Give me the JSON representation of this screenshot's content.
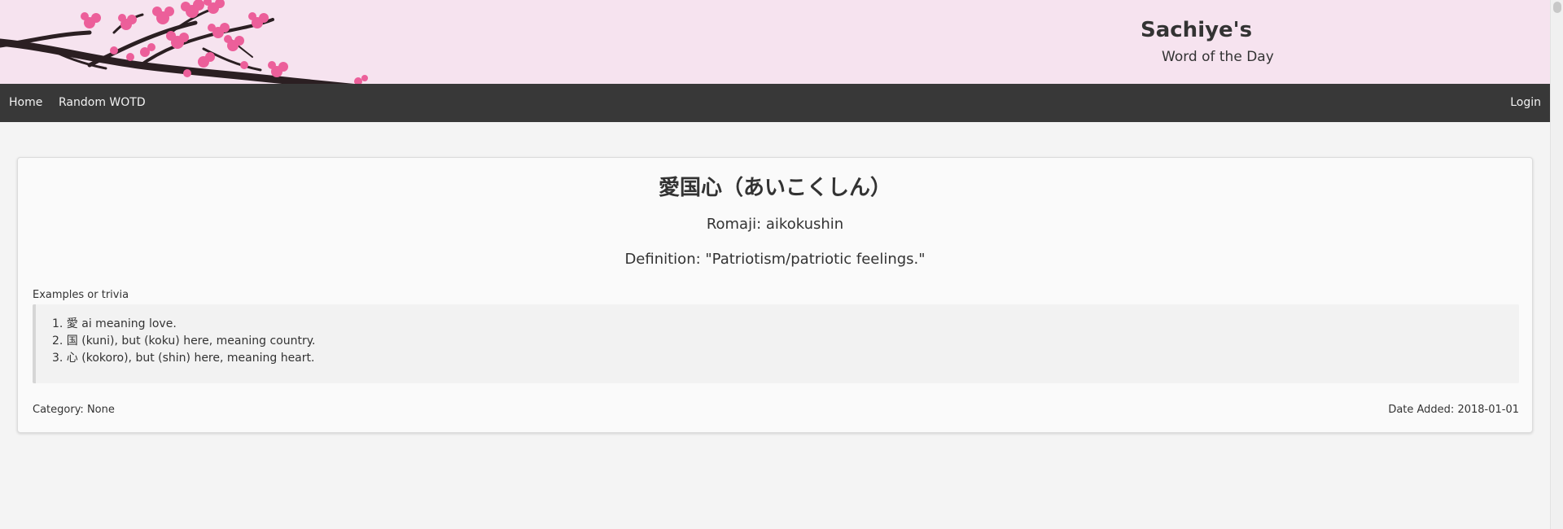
{
  "header": {
    "title": "Sachiye's",
    "subtitle": "Word of the Day"
  },
  "nav": {
    "home_label": "Home",
    "random_label": "Random WOTD",
    "login_label": "Login"
  },
  "word": {
    "title": "愛国心（あいこくしん）",
    "romaji": "Romaji: aikokushin",
    "definition": "Definition: \"Patriotism/patriotic feelings.\""
  },
  "trivia": {
    "label": "Examples or trivia",
    "items": [
      "1. 愛 ai meaning love.",
      "2. 国 (kuni), but (koku) here, meaning country.",
      "3. 心 (kokoro), but (shin) here, meaning heart."
    ]
  },
  "footer": {
    "category": "Category: None",
    "date_added": "Date Added: 2018-01-01"
  },
  "colors": {
    "banner_bg": "#f6e3ef",
    "navbar_bg": "#383838",
    "blossom": "#ec5f9a",
    "branch": "#2b1f22"
  }
}
